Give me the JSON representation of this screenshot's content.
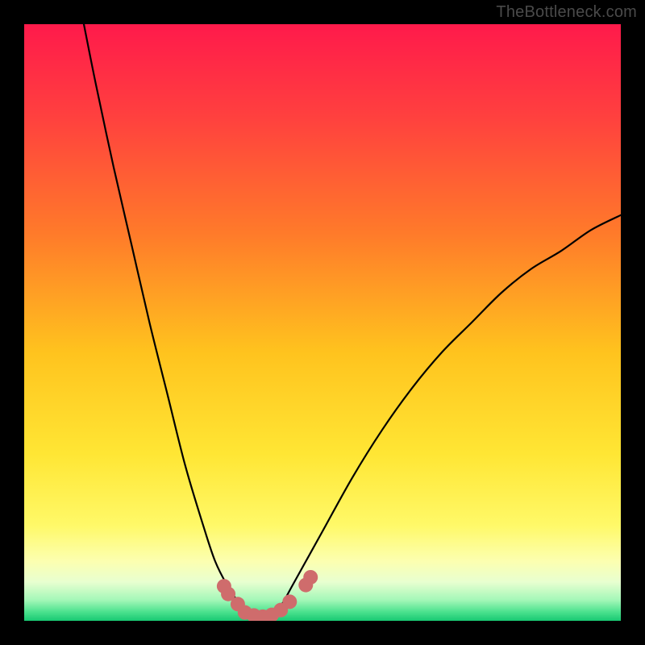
{
  "attribution": "TheBottleneck.com",
  "chart_data": {
    "type": "line",
    "title": "",
    "xlabel": "",
    "ylabel": "",
    "xlim": [
      0,
      100
    ],
    "ylim": [
      0,
      100
    ],
    "curve": {
      "x": [
        10,
        12,
        15,
        18,
        21,
        24,
        27,
        30,
        32,
        34,
        36,
        37.5,
        39,
        40,
        41,
        43,
        45,
        50,
        55,
        60,
        65,
        70,
        75,
        80,
        85,
        90,
        95,
        100
      ],
      "y": [
        100,
        90,
        76,
        63,
        50,
        38,
        26,
        16,
        10,
        6,
        3,
        1.5,
        0.8,
        0.6,
        0.8,
        2.5,
        6,
        15,
        24,
        32,
        39,
        45,
        50,
        55,
        59,
        62,
        65.5,
        68
      ]
    },
    "green_band": {
      "y0": 0,
      "y1": 6
    },
    "markers": {
      "x": [
        33.5,
        34.2,
        35.8,
        37.0,
        38.5,
        40.0,
        41.5,
        43.0,
        44.5,
        47.2,
        48.0
      ],
      "y": [
        5.8,
        4.5,
        2.8,
        1.4,
        0.9,
        0.7,
        1.0,
        1.8,
        3.2,
        6.0,
        7.3
      ],
      "color": "#cf6c6c"
    },
    "gradient_stops": [
      {
        "offset": 0.0,
        "color": "#ff1a4b"
      },
      {
        "offset": 0.15,
        "color": "#ff3f3f"
      },
      {
        "offset": 0.35,
        "color": "#ff7a2a"
      },
      {
        "offset": 0.55,
        "color": "#ffc31e"
      },
      {
        "offset": 0.72,
        "color": "#ffe634"
      },
      {
        "offset": 0.84,
        "color": "#fff968"
      },
      {
        "offset": 0.9,
        "color": "#fcffb0"
      },
      {
        "offset": 0.935,
        "color": "#e8ffd0"
      },
      {
        "offset": 0.965,
        "color": "#a4f7b8"
      },
      {
        "offset": 0.985,
        "color": "#4ce28e"
      },
      {
        "offset": 1.0,
        "color": "#18c872"
      }
    ]
  }
}
